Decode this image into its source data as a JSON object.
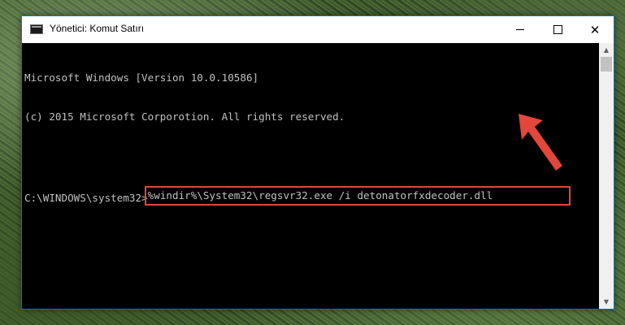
{
  "window": {
    "title": "Yönetici: Komut Satırı",
    "controls": {
      "minimize": "minimize",
      "maximize": "maximize",
      "close": "✕"
    }
  },
  "console": {
    "lines": [
      "Microsoft Windows [Version 10.0.10586]",
      "(c) 2015 Microsoft Corporotion. All rights reserved."
    ],
    "prompt": "C:\\WINDOWS\\system32>",
    "command": "%windir%\\System32\\regsvr32.exe /i detonatorfxdecoder.dll"
  },
  "scrollbar": {
    "up_icon": "▲",
    "down_icon": "▼"
  },
  "colors": {
    "highlight": "#e3463a",
    "console_text": "#c0c0c0",
    "console_bg": "#000000",
    "window_border": "#1a6fb5"
  },
  "icons": [
    "console-app-icon",
    "minimize-icon",
    "maximize-icon",
    "close-icon",
    "scroll-up-icon",
    "scroll-down-icon",
    "red-pointer-arrow"
  ]
}
